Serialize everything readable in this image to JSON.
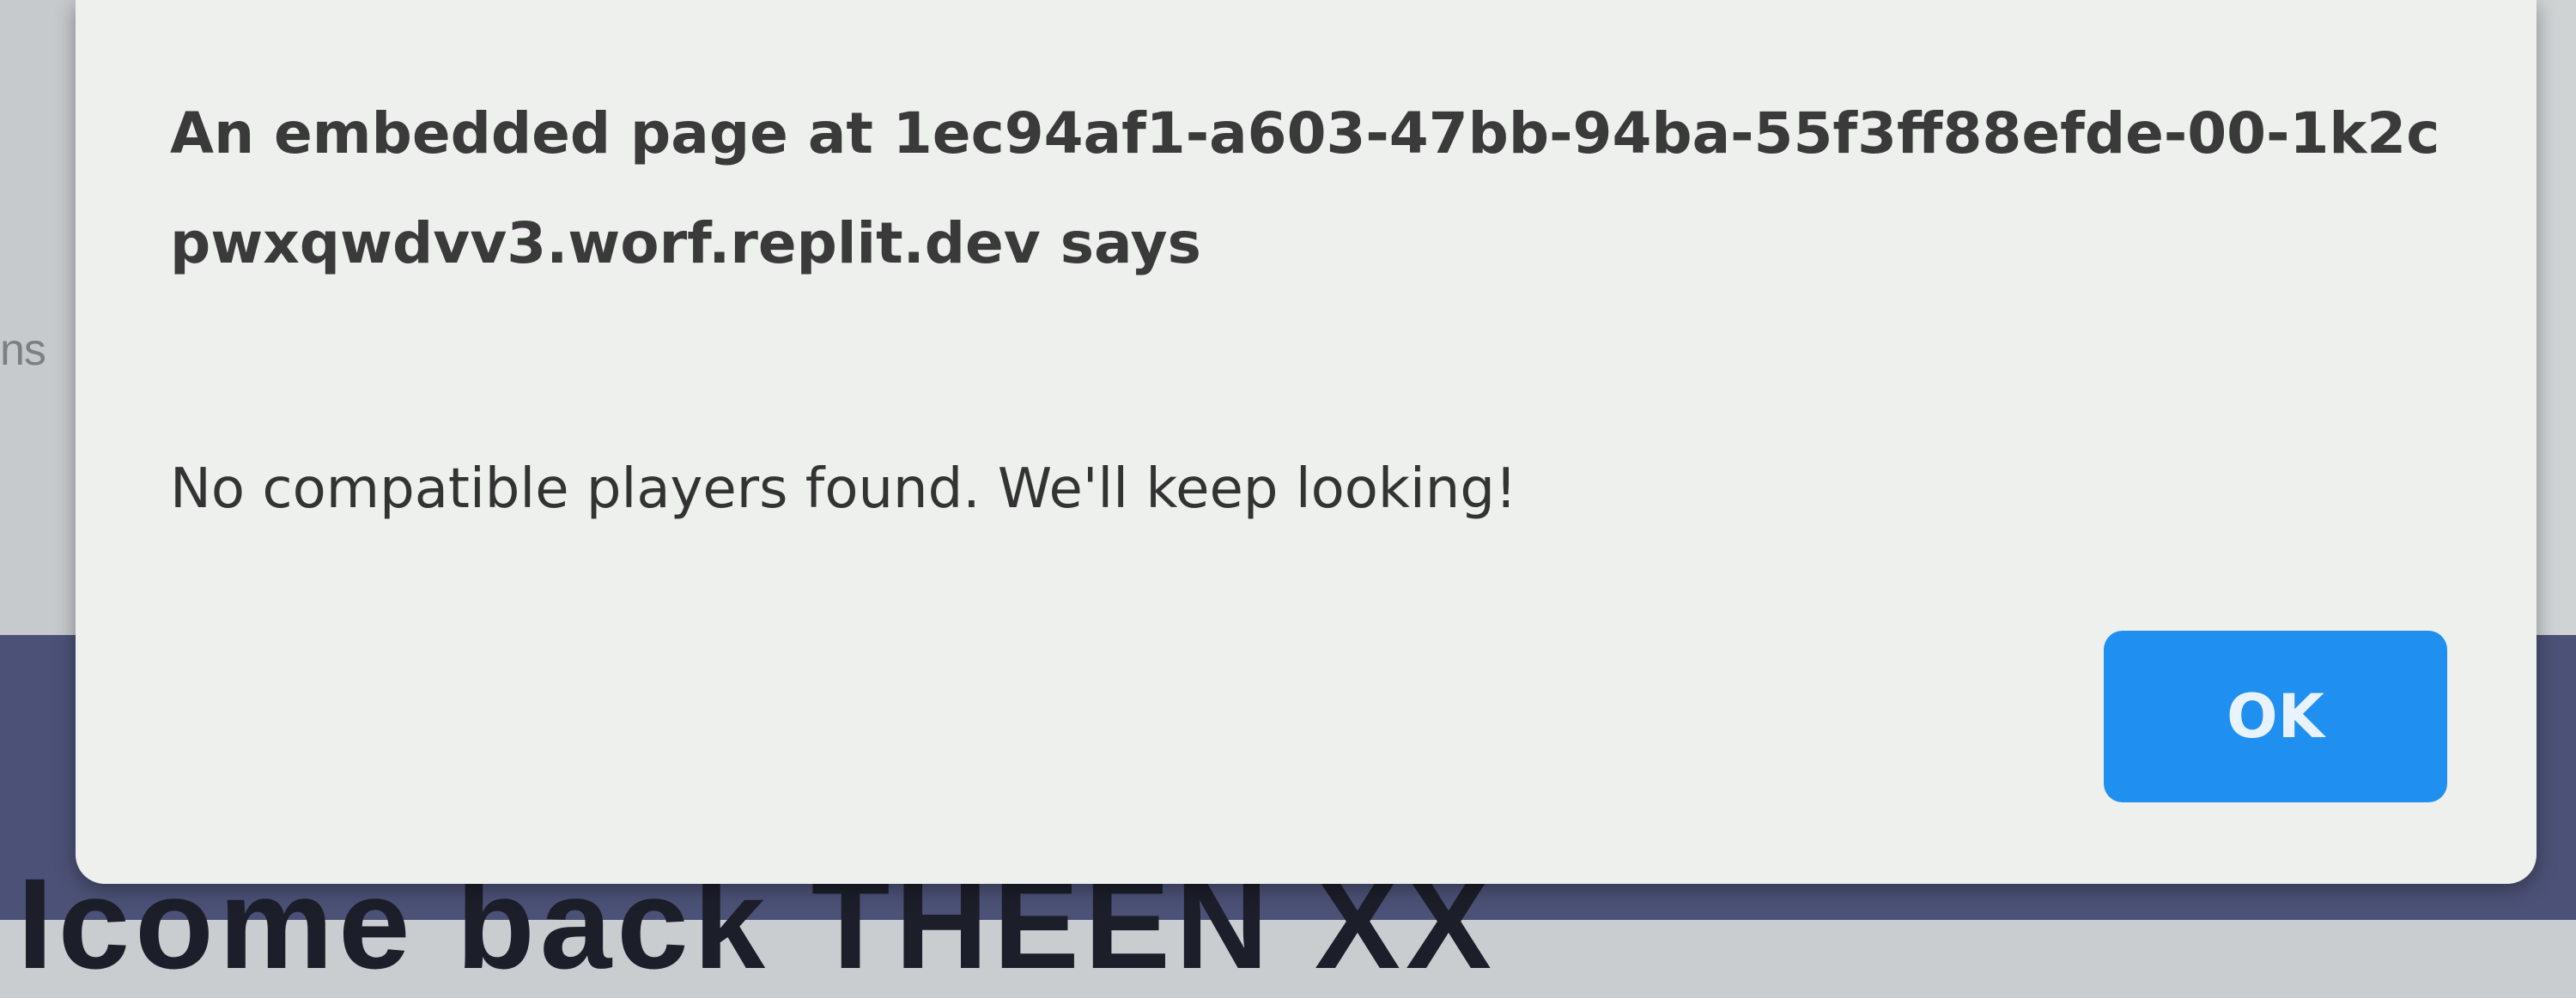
{
  "background": {
    "left_partial_text": "ns",
    "bottom_partial_text": "Icome back THEEN XX"
  },
  "dialog": {
    "title": "An embedded page at 1ec94af1-a603-47bb-94ba-55f3ff88efde-00-1k2cpwxqwdvv3.worf.replit.dev says",
    "message": "No compatible players found. We'll keep looking!",
    "ok_label": "OK"
  },
  "colors": {
    "dialog_background": "#eef0ee",
    "ok_button": "#1f8ff0",
    "page_bottom_band": "#4c5277"
  }
}
